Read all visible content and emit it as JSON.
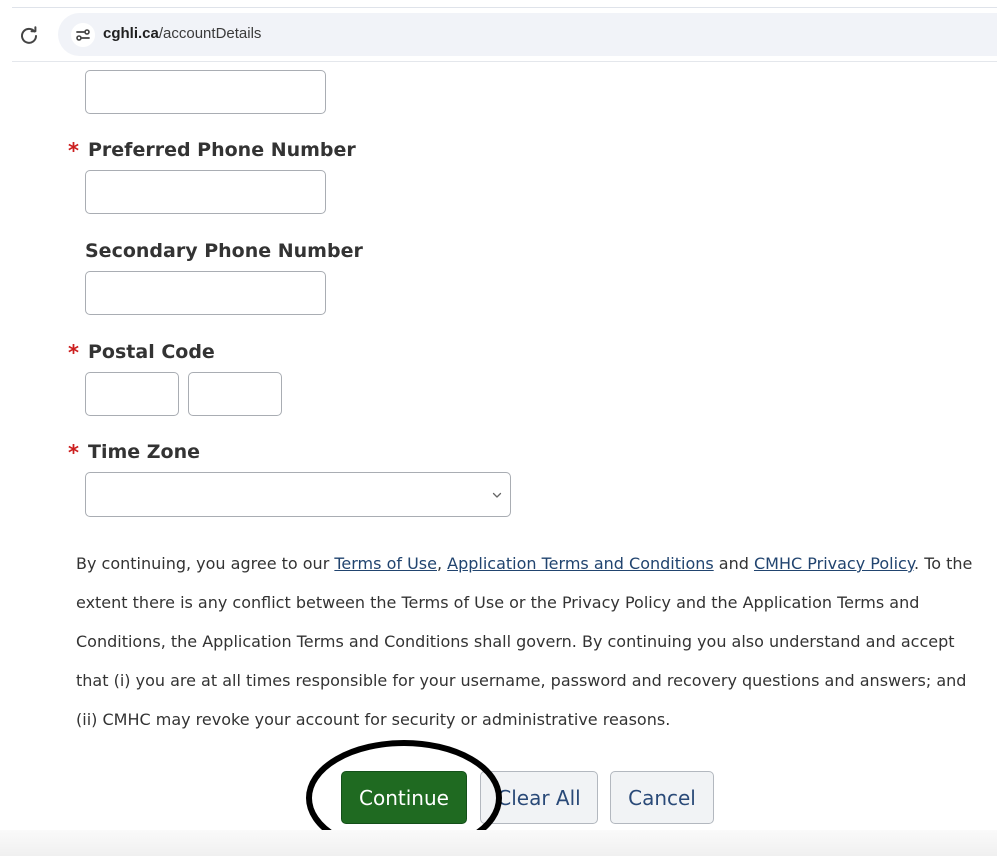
{
  "browser": {
    "url_host": "cghli.ca",
    "url_path": "/accountDetails"
  },
  "form": {
    "preferred_phone": {
      "label": "Preferred Phone Number",
      "required_mark": "*",
      "value": ""
    },
    "secondary_phone": {
      "label": "Secondary Phone Number",
      "value": ""
    },
    "postal_code": {
      "label": "Postal Code",
      "required_mark": "*",
      "part1": "",
      "part2": ""
    },
    "time_zone": {
      "label": "Time Zone",
      "required_mark": "*",
      "selected": ""
    }
  },
  "terms": {
    "intro": "By continuing, you agree to our ",
    "link_terms": "Terms of Use",
    "sep1": ", ",
    "link_app_terms": "Application Terms and Conditions",
    "sep2": " and ",
    "link_privacy": "CMHC Privacy Policy",
    "rest": ". To the extent there is any conflict between the Terms of Use or the Privacy Policy and the Application Terms and Conditions, the Application Terms and Conditions shall govern. By continuing you also understand and accept that (i) you are at all times responsible for your username, password and recovery questions and answers; and (ii) CMHC may revoke your account for security or administrative reasons."
  },
  "buttons": {
    "continue_label": "Continue",
    "clear_label": "Clear All",
    "cancel_label": "Cancel"
  },
  "colors": {
    "primary": "#1f6a21",
    "required": "#cc1f1f",
    "link": "#21446f"
  }
}
